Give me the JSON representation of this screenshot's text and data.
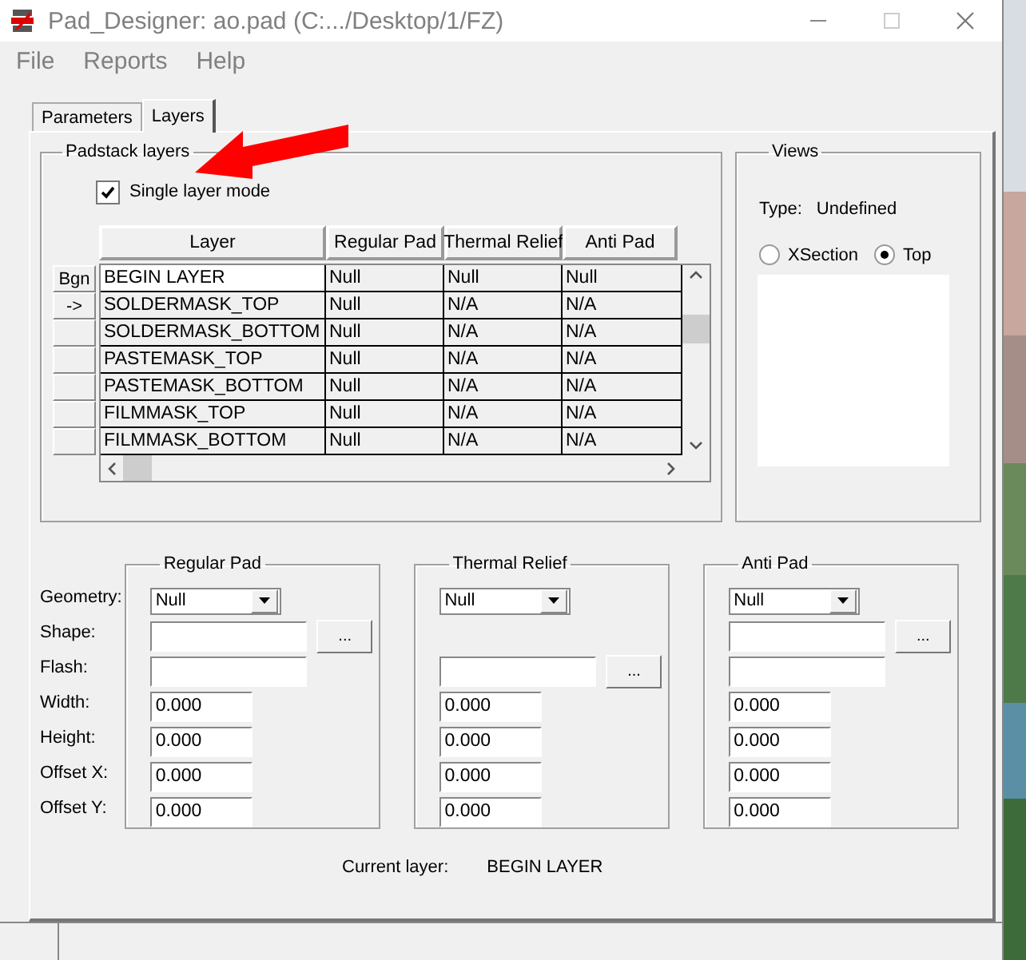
{
  "window": {
    "title": "Pad_Designer: ao.pad (C:.../Desktop/1/FZ)"
  },
  "menu": [
    "File",
    "Reports",
    "Help"
  ],
  "tabs": [
    {
      "label": "Parameters",
      "selected": false
    },
    {
      "label": "Layers",
      "selected": true
    }
  ],
  "padstack": {
    "title": "Padstack layers",
    "single_layer_mode": {
      "label": "Single layer mode",
      "checked": true
    },
    "columns": [
      "Layer",
      "Regular Pad",
      "Thermal Relief",
      "Anti Pad"
    ],
    "rows": [
      {
        "button": "Bgn",
        "layer": "BEGIN LAYER",
        "regular_pad": "Null",
        "thermal_relief": "Null",
        "anti_pad": "Null",
        "selected": true
      },
      {
        "button": "->",
        "layer": "SOLDERMASK_TOP",
        "regular_pad": "Null",
        "thermal_relief": "N/A",
        "anti_pad": "N/A",
        "selected": false
      },
      {
        "layer": "SOLDERMASK_BOTTOM",
        "regular_pad": "Null",
        "thermal_relief": "N/A",
        "anti_pad": "N/A",
        "selected": false
      },
      {
        "layer": "PASTEMASK_TOP",
        "regular_pad": "Null",
        "thermal_relief": "N/A",
        "anti_pad": "N/A",
        "selected": false
      },
      {
        "layer": "PASTEMASK_BOTTOM",
        "regular_pad": "Null",
        "thermal_relief": "N/A",
        "anti_pad": "N/A",
        "selected": false
      },
      {
        "layer": "FILMMASK_TOP",
        "regular_pad": "Null",
        "thermal_relief": "N/A",
        "anti_pad": "N/A",
        "selected": false
      },
      {
        "layer": "FILMMASK_BOTTOM",
        "regular_pad": "Null",
        "thermal_relief": "N/A",
        "anti_pad": "N/A",
        "selected": false
      }
    ]
  },
  "views": {
    "title": "Views",
    "type_label": "Type:",
    "type_value": "Undefined",
    "options": [
      {
        "label": "XSection",
        "selected": false
      },
      {
        "label": "Top",
        "selected": true
      }
    ]
  },
  "field_labels": [
    "Geometry:",
    "Shape:",
    "Flash:",
    "Width:",
    "Height:",
    "Offset X:",
    "Offset Y:"
  ],
  "pad_groups": [
    {
      "title": "Regular Pad",
      "fields": [
        {
          "kind": "dropdown",
          "value": "Null"
        },
        {
          "kind": "browse",
          "button": "..."
        },
        {
          "kind": "text"
        },
        {
          "kind": "number",
          "value": "0.000"
        },
        {
          "kind": "number",
          "value": "0.000"
        },
        {
          "kind": "number",
          "value": "0.000"
        },
        {
          "kind": "number",
          "value": "0.000"
        }
      ]
    },
    {
      "title": "Thermal Relief",
      "fields": [
        {
          "kind": "dropdown",
          "value": "Null"
        },
        {
          "kind": "none"
        },
        {
          "kind": "browse",
          "button": "..."
        },
        {
          "kind": "number",
          "value": "0.000"
        },
        {
          "kind": "number",
          "value": "0.000"
        },
        {
          "kind": "number",
          "value": "0.000"
        },
        {
          "kind": "number",
          "value": "0.000"
        }
      ]
    },
    {
      "title": "Anti Pad",
      "fields": [
        {
          "kind": "dropdown",
          "value": "Null"
        },
        {
          "kind": "browse",
          "button": "..."
        },
        {
          "kind": "text"
        },
        {
          "kind": "number",
          "value": "0.000"
        },
        {
          "kind": "number",
          "value": "0.000"
        },
        {
          "kind": "number",
          "value": "0.000"
        },
        {
          "kind": "number",
          "value": "0.000"
        }
      ]
    }
  ],
  "current_layer": {
    "label": "Current layer:",
    "value": "BEGIN LAYER"
  }
}
